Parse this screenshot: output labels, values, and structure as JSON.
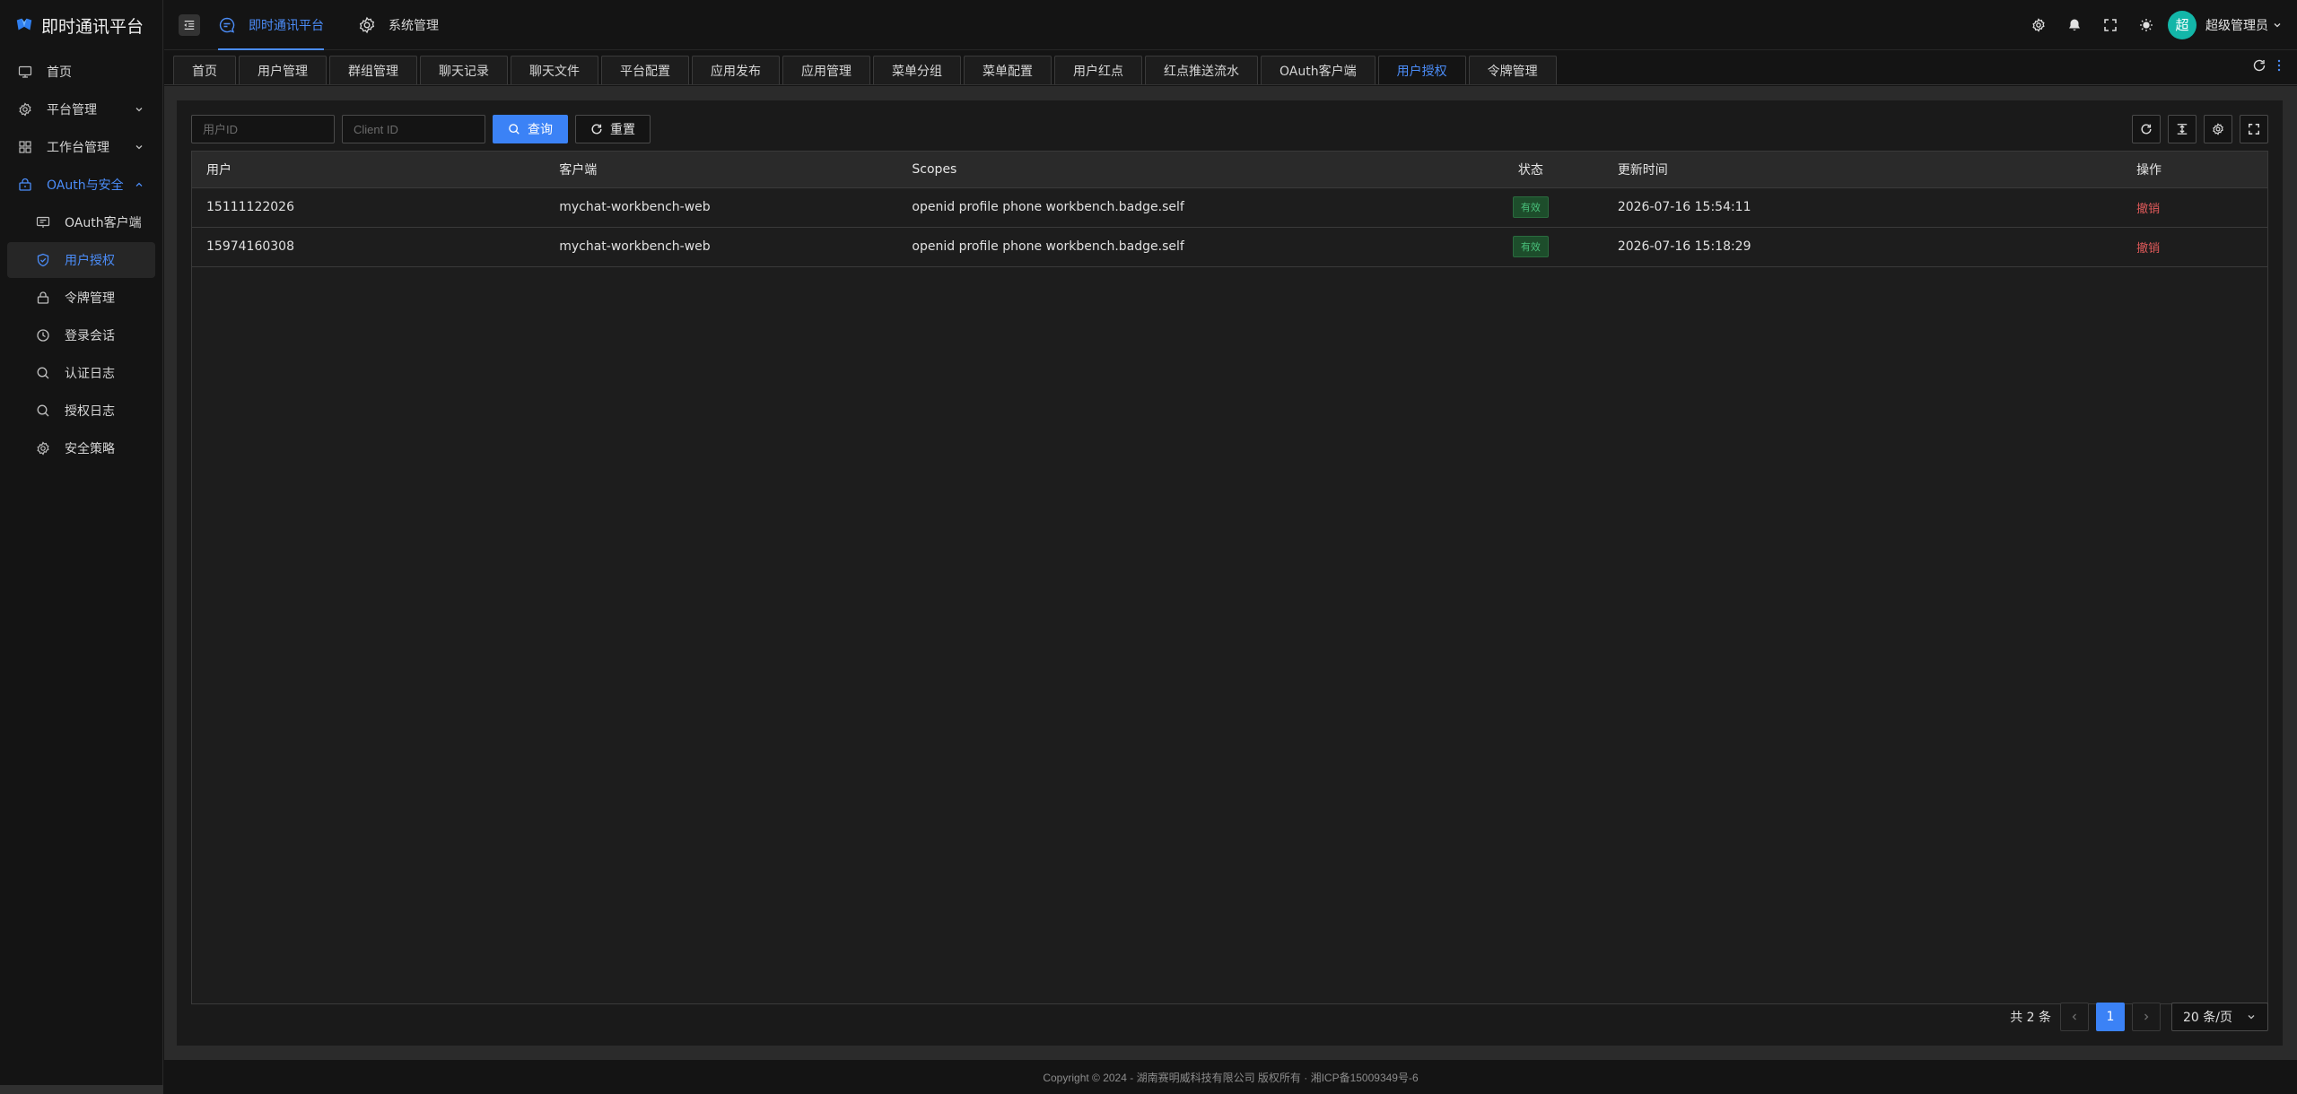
{
  "app": {
    "title": "即时通讯平台",
    "accent_color": "#3b82f6"
  },
  "sidebar": {
    "items": [
      {
        "label": "首页",
        "icon": "monitor-icon"
      },
      {
        "label": "平台管理",
        "icon": "gear-icon"
      },
      {
        "label": "工作台管理",
        "icon": "grid-icon"
      },
      {
        "label": "OAuth与安全",
        "icon": "lock-bag-icon"
      },
      {
        "label": "OAuth客户端",
        "icon": "client-icon"
      },
      {
        "label": "用户授权",
        "icon": "shield-check-icon"
      },
      {
        "label": "令牌管理",
        "icon": "lock-icon"
      },
      {
        "label": "登录会话",
        "icon": "clock-icon"
      },
      {
        "label": "认证日志",
        "icon": "search-icon"
      },
      {
        "label": "授权日志",
        "icon": "search-icon"
      },
      {
        "label": "安全策略",
        "icon": "gear-icon"
      }
    ]
  },
  "header": {
    "nav": [
      {
        "label": "即时通讯平台",
        "icon": "chat-icon"
      },
      {
        "label": "系统管理",
        "icon": "gear-icon"
      }
    ],
    "avatar_text": "超",
    "user_name": "超级管理员"
  },
  "tabs": [
    "首页",
    "用户管理",
    "群组管理",
    "聊天记录",
    "聊天文件",
    "平台配置",
    "应用发布",
    "应用管理",
    "菜单分组",
    "菜单配置",
    "用户红点",
    "红点推送流水",
    "OAuth客户端",
    "用户授权",
    "令牌管理"
  ],
  "search": {
    "user_id_placeholder": "用户ID",
    "user_id_value": "",
    "client_id_placeholder": "Client ID",
    "client_id_value": "",
    "query_label": "查询",
    "reset_label": "重置"
  },
  "table": {
    "columns": [
      "用户",
      "客户端",
      "Scopes",
      "状态",
      "更新时间",
      "操作"
    ],
    "rows": [
      {
        "user": "15111122026",
        "client": "mychat-workbench-web",
        "scopes": "openid profile phone workbench.badge.self",
        "status": "有效",
        "updated": "2026-07-16 15:54:11",
        "action": "撤销"
      },
      {
        "user": "15974160308",
        "client": "mychat-workbench-web",
        "scopes": "openid profile phone workbench.badge.self",
        "status": "有效",
        "updated": "2026-07-16 15:18:29",
        "action": "撤销"
      }
    ]
  },
  "pagination": {
    "total_text": "共 2 条",
    "current_page": "1",
    "page_size": "20 条/页"
  },
  "footer": {
    "text": "Copyright © 2024 - 湖南赛明威科技有限公司 版权所有 · 湘ICP备15009349号-6"
  }
}
